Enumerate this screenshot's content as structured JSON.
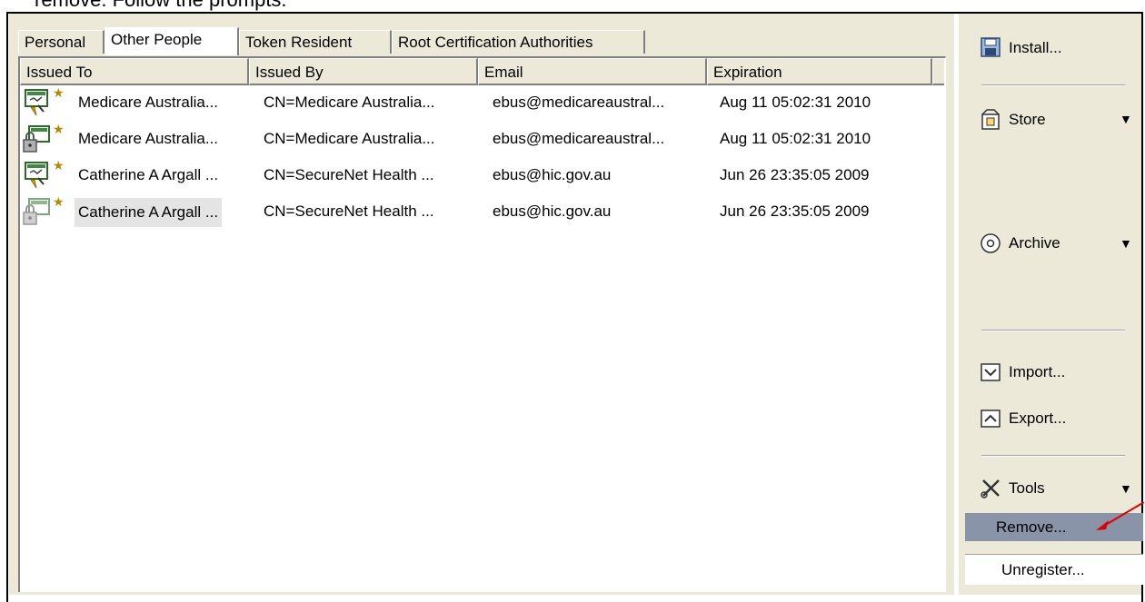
{
  "caption": "remove. Follow the prompts.",
  "tabs": [
    {
      "label": "Personal"
    },
    {
      "label": "Other People"
    },
    {
      "label": "Token Resident"
    },
    {
      "label": "Root Certification Authorities"
    }
  ],
  "active_tab": "Other People",
  "columns": [
    "Issued To",
    "Issued By",
    "Email",
    "Expiration"
  ],
  "rows": [
    {
      "issued_to": "Medicare Australia...",
      "issued_by": "CN=Medicare Australia...",
      "email": "ebus@medicareaustral...",
      "expiration": "Aug 11 05:02:31 2010",
      "icon": "cert-signing-icon"
    },
    {
      "issued_to": "Medicare Australia...",
      "issued_by": "CN=Medicare Australia...",
      "email": "ebus@medicareaustral...",
      "expiration": "Aug 11 05:02:31 2010",
      "icon": "cert-encryption-icon"
    },
    {
      "issued_to": "Catherine A Argall ...",
      "issued_by": "CN=SecureNet Health ...",
      "email": "ebus@hic.gov.au",
      "expiration": "Jun 26 23:35:05 2009",
      "icon": "cert-signing-icon"
    },
    {
      "issued_to": "Catherine A Argall ...",
      "issued_by": "CN=SecureNet Health ...",
      "email": "ebus@hic.gov.au",
      "expiration": "Jun 26 23:35:05 2009",
      "icon": "cert-encryption-icon"
    }
  ],
  "panel": {
    "install": "Install...",
    "store": "Store",
    "archive": "Archive",
    "import": "Import...",
    "export": "Export...",
    "tools": "Tools",
    "tools_menu": {
      "remove": "Remove...",
      "unregister": "Unregister..."
    }
  },
  "colors": {
    "highlight": "#8a94a8",
    "arrow": "#e00000",
    "window_bg": "#ece9d8"
  }
}
